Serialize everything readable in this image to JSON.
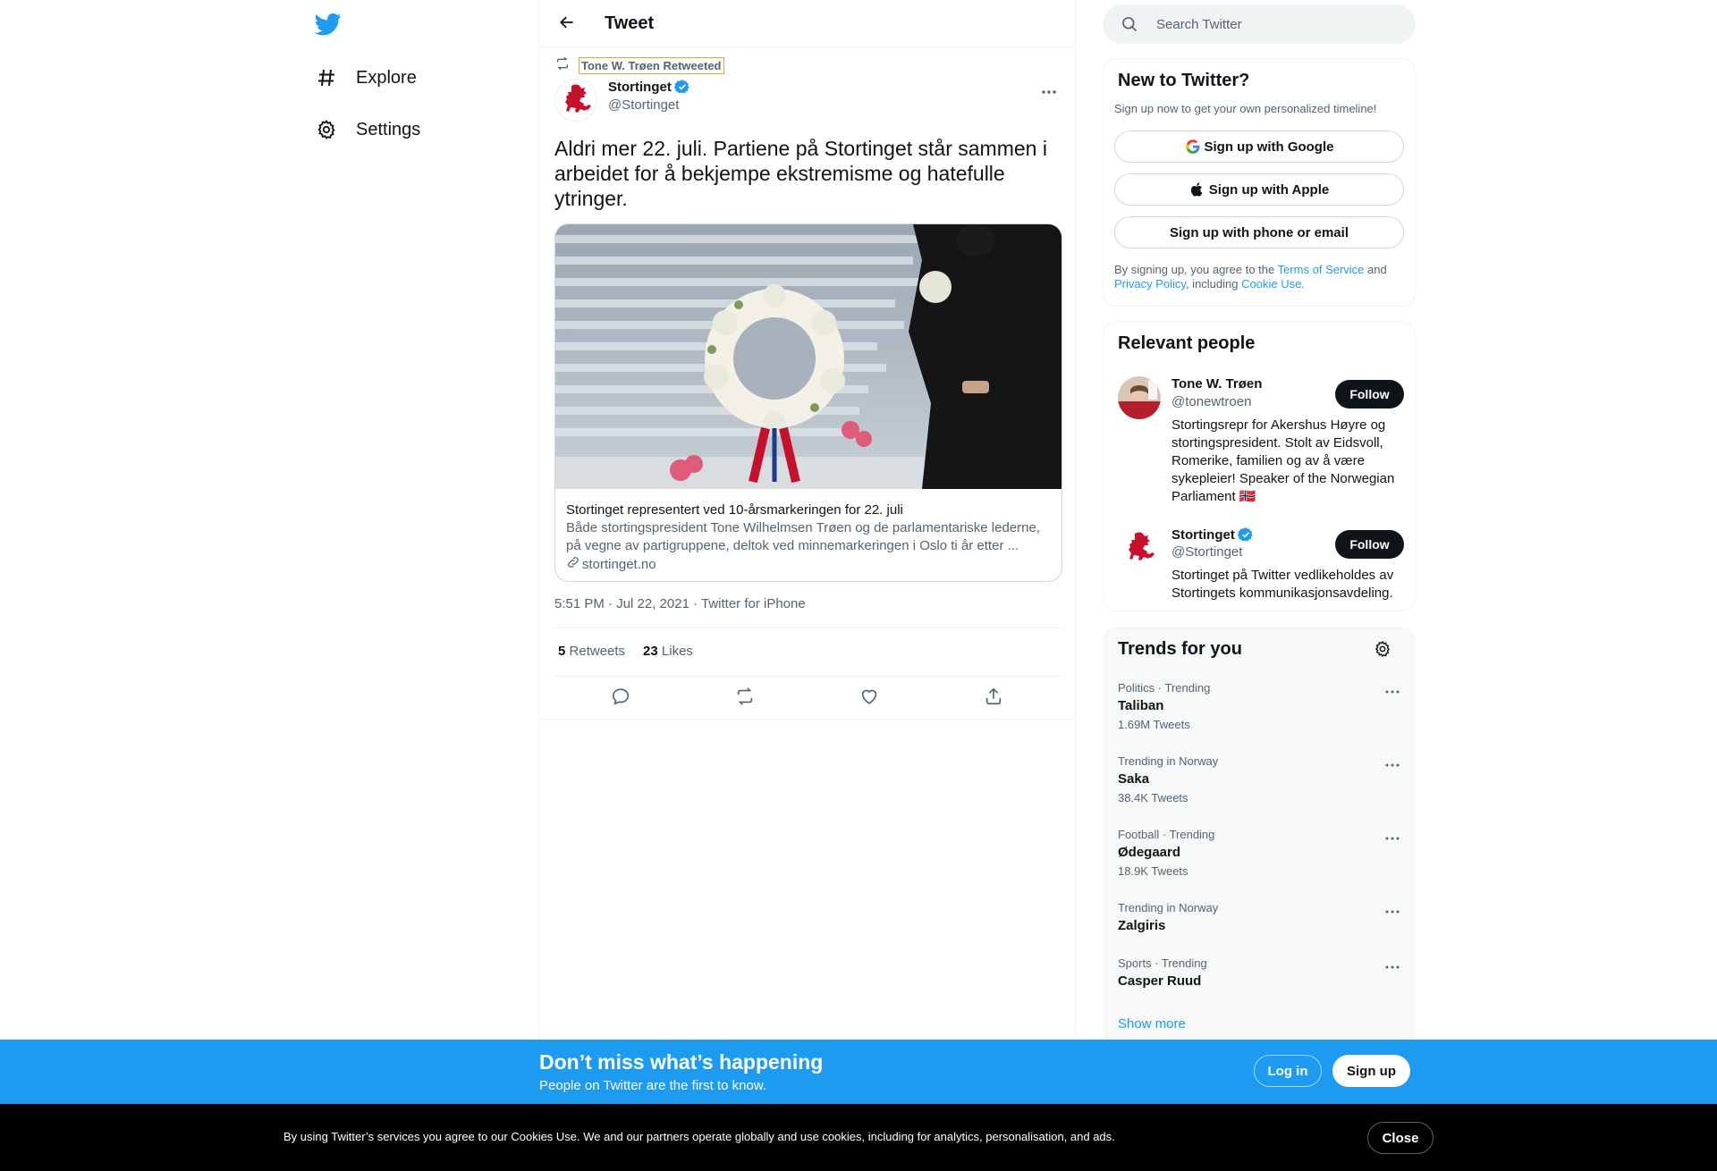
{
  "colors": {
    "brand": "#1d9bf0",
    "text": "#0f1419",
    "muted": "#536471",
    "banner": "#1d9bf0",
    "cookie_bar": "#000000"
  },
  "nav": {
    "logo_icon": "twitter-bird-icon",
    "items": [
      {
        "icon": "hashtag-icon",
        "label": "Explore"
      },
      {
        "icon": "gear-icon",
        "label": "Settings"
      }
    ]
  },
  "header": {
    "back_icon": "arrow-left-icon",
    "title": "Tweet"
  },
  "tweet": {
    "retweeted_by": "Tone W. Trøen Retweeted",
    "author": {
      "name": "Stortinget",
      "handle": "@Stortinget",
      "verified": true
    },
    "text": "Aldri mer 22. juli. Partiene på Stortinget står sammen i arbeidet for å bekjempe ekstremisme og hatefulle ytringer.",
    "card": {
      "title": "Stortinget representert ved 10-årsmarkeringen for 22. juli",
      "description": "Både stortingspresident Tone Wilhelmsen Trøen og de parlamentariske lederne, på vegne av partigruppene, deltok ved minnemarkeringen i Oslo ti år etter ...",
      "domain": "stortinget.no"
    },
    "timestamp": "5:51 PM · Jul 22, 2021 · Twitter for iPhone",
    "retweets": {
      "count": "5",
      "label": "Retweets"
    },
    "likes": {
      "count": "23",
      "label": "Likes"
    },
    "actions": [
      "reply-icon",
      "retweet-icon",
      "like-icon",
      "share-icon"
    ]
  },
  "search": {
    "placeholder": "Search Twitter"
  },
  "new_to_twitter": {
    "title": "New to Twitter?",
    "subtitle": "Sign up now to get your own personalized timeline!",
    "google": "Sign up with Google",
    "apple": "Sign up with Apple",
    "phone": "Sign up with phone or email",
    "legal_prefix": "By signing up, you agree to the ",
    "terms": "Terms of Service",
    "and": " and ",
    "privacy": "Privacy Policy",
    "including": ", including ",
    "cookie": "Cookie Use."
  },
  "relevant_people": {
    "title": "Relevant people",
    "people": [
      {
        "name": "Tone W. Trøen",
        "handle": "@tonewtroen",
        "bio": "Stortingsrepr for Akershus Høyre og stortingspresident. Stolt av Eidsvoll, Romerike, familien og av å være sykepleier! Speaker of the Norwegian Parliament 🇳🇴",
        "follow": "Follow",
        "verified": false
      },
      {
        "name": "Stortinget",
        "handle": "@Stortinget",
        "bio": "Stortinget på Twitter vedlikeholdes av Stortingets kommunikasjonsavdeling.",
        "follow": "Follow",
        "verified": true
      }
    ]
  },
  "trends": {
    "title": "Trends for you",
    "items": [
      {
        "context": "Politics · Trending",
        "name": "Taliban",
        "count": "1.69M Tweets"
      },
      {
        "context": "Trending in Norway",
        "name": "Saka",
        "count": "38.4K Tweets"
      },
      {
        "context": "Football · Trending",
        "name": "Ødegaard",
        "count": "18.9K Tweets"
      },
      {
        "context": "Trending in Norway",
        "name": "Zalgiris",
        "count": ""
      },
      {
        "context": "Sports · Trending",
        "name": "Casper Ruud",
        "count": ""
      }
    ],
    "show_more": "Show more"
  },
  "banner": {
    "title": "Don’t miss what’s happening",
    "subtitle": "People on Twitter are the first to know.",
    "login": "Log in",
    "signup": "Sign up"
  },
  "cookie_bar": {
    "text": "By using Twitter’s services you agree to our Cookies Use. We and our partners operate globally and use cookies, including for analytics, personalisation, and ads.",
    "close": "Close"
  }
}
